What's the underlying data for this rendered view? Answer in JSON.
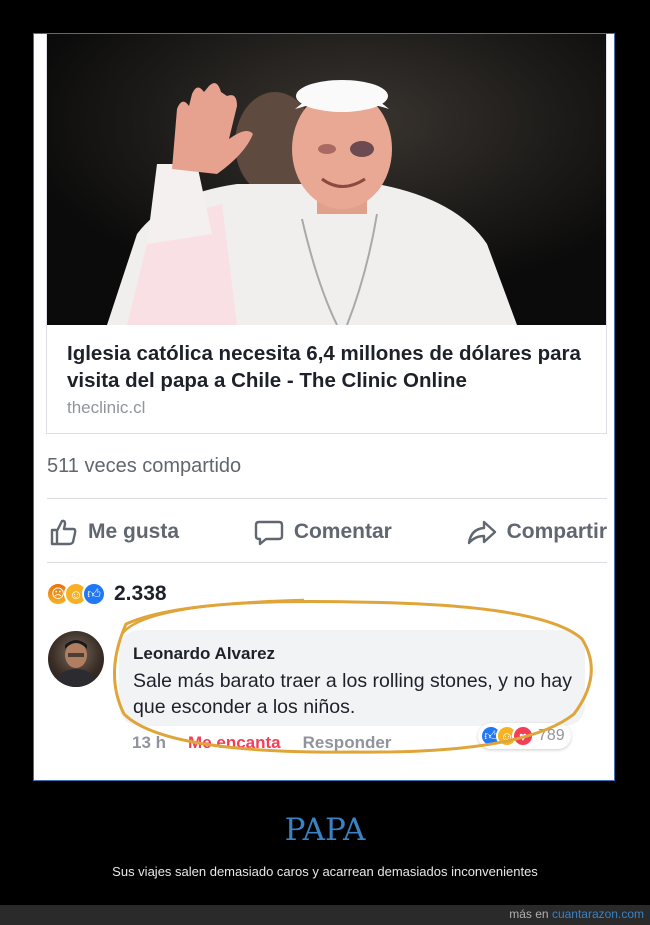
{
  "post": {
    "link_title": "Iglesia católica necesita 6,4 millones de dólares para visita del papa a Chile - The Clinic Online",
    "link_domain": "theclinic.cl",
    "shares": "511 veces compartido",
    "actions": {
      "like": "Me gusta",
      "comment": "Comentar",
      "share": "Compartir"
    },
    "reaction_count": "2.338",
    "reaction_icons": [
      "angry-icon",
      "haha-icon",
      "like-icon"
    ]
  },
  "comment": {
    "author": "Leonardo Alvarez",
    "text": "Sale más barato traer a los rolling stones, y no hay que esconder a los niños.",
    "time": "13 h",
    "love_action": "Me encanta",
    "reply_action": "Responder",
    "reaction_count": "789",
    "reaction_icons": [
      "like-icon",
      "haha-icon",
      "love-icon"
    ],
    "highlight_color": "#e0a53a"
  },
  "caption": {
    "title": "PAPA",
    "subtitle": "Sus viajes salen demasiado caros y acarrean demasiados inconvenientes"
  },
  "footer": {
    "prefix": "más en",
    "site": "cuantarazon.com"
  },
  "colors": {
    "accent": "#3a82c4",
    "facebook_blue": "#2078f4"
  }
}
